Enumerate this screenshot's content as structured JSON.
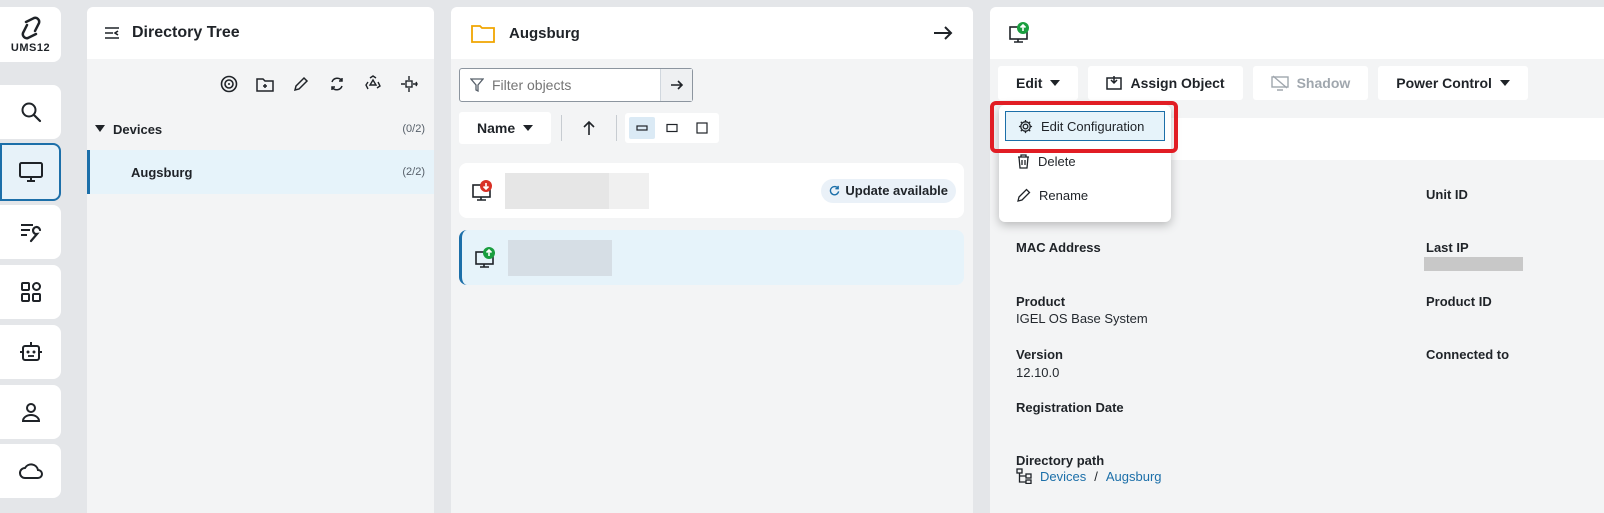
{
  "rail": {
    "logo_text": "UMS12",
    "items": [
      {
        "icon": "search-icon"
      },
      {
        "icon": "monitor-icon",
        "active": true
      },
      {
        "icon": "configuration-wrench-icon"
      },
      {
        "icon": "apps-grid-icon"
      },
      {
        "icon": "robot-icon"
      },
      {
        "icon": "user-icon"
      },
      {
        "icon": "cloud-icon"
      }
    ]
  },
  "tree": {
    "title": "Directory Tree",
    "tools": [
      "target-icon",
      "new-folder-icon",
      "edit-pencil-icon",
      "refresh-icon",
      "recycle-bin-icon",
      "move-icon"
    ],
    "nodes": [
      {
        "label": "Devices",
        "count": "(0/2)"
      },
      {
        "label": "Augsburg",
        "count": "(2/2)"
      }
    ]
  },
  "middle": {
    "title": "Augsburg",
    "filter_placeholder": "Filter objects",
    "sort_label": "Name",
    "devices": [
      {
        "status": "download",
        "badge": "Update available"
      },
      {
        "status": "online",
        "badge": ""
      }
    ]
  },
  "right": {
    "actions": {
      "edit": "Edit",
      "assign": "Assign Object",
      "shadow": "Shadow",
      "power": "Power Control"
    },
    "menu": {
      "items": [
        "Edit Configuration",
        "Delete",
        "Rename"
      ]
    },
    "fields": {
      "unit_id_label": "Unit ID",
      "mac_label": "MAC Address",
      "last_ip_label": "Last IP",
      "product_label": "Product",
      "product_value": "IGEL OS Base System",
      "product_id_label": "Product ID",
      "version_label": "Version",
      "version_value": "12.10.0",
      "connected_label": "Connected to",
      "reg_date_label": "Registration Date",
      "dir_path_label": "Directory path",
      "path": [
        "Devices",
        "Augsburg"
      ],
      "path_sep": "/"
    }
  },
  "colors": {
    "accent": "#1c6fa9",
    "highlight": "#e11d24",
    "folder": "#f0a500",
    "online": "#1a9e3f",
    "alert": "#d93025"
  }
}
